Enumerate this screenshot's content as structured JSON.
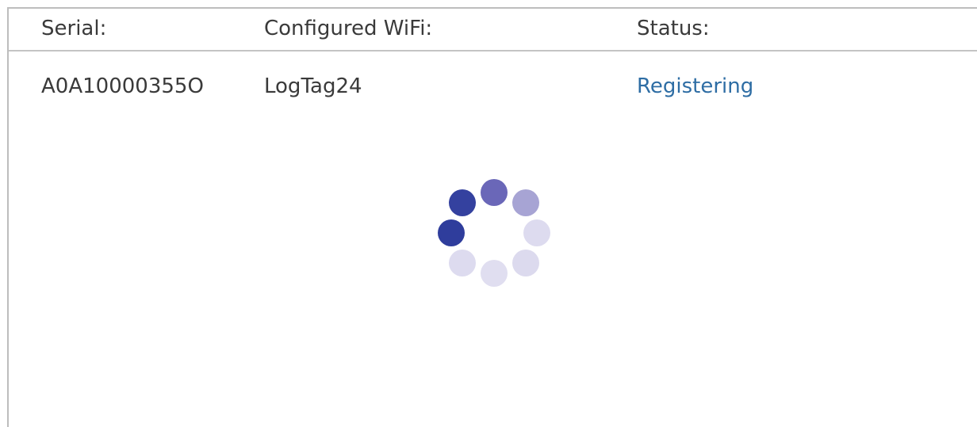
{
  "table": {
    "headers": {
      "serial": "Serial:",
      "wifi": "Configured WiFi:",
      "status": "Status:"
    },
    "rows": [
      {
        "serial": "A0A10000355O",
        "wifi": "LogTag24",
        "status": "Registering"
      }
    ]
  },
  "colors": {
    "status_link": "#2e6da4",
    "spinner_dark": "#2f3d9c",
    "spinner_light": "#d6d4ec"
  },
  "spinner": {
    "icon": "loading-spinner-icon",
    "dot_count": 8
  }
}
